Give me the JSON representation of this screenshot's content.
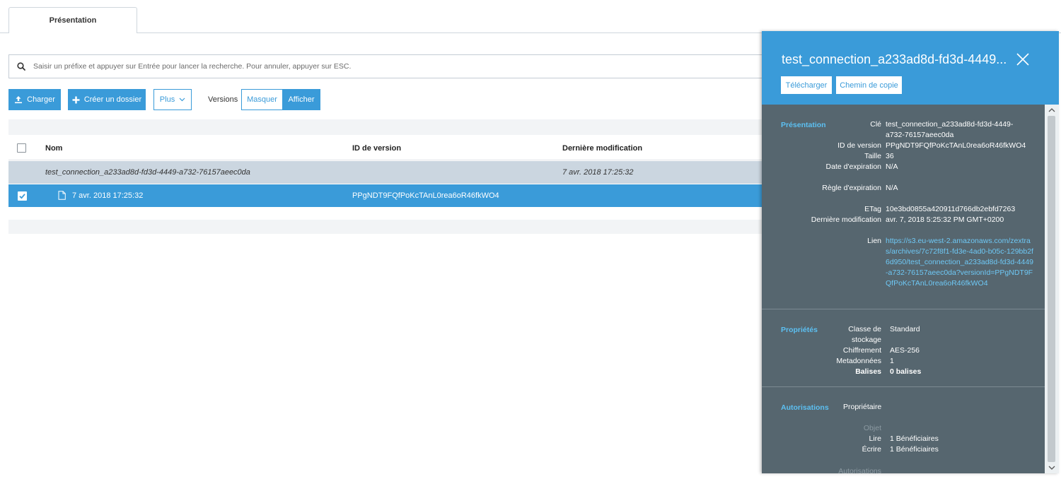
{
  "tabs": [
    {
      "label": "Présentation",
      "active": true
    }
  ],
  "search": {
    "placeholder": "Saisir un préfixe et appuyer sur Entrée pour lancer la recherche. Pour annuler, appuyer sur ESC."
  },
  "toolbar": {
    "upload_label": "Charger",
    "create_folder_label": "Créer un dossier",
    "more_label": "Plus",
    "versions_label": "Versions",
    "hide_label": "Masquer",
    "show_label": "Afficher"
  },
  "table": {
    "columns": {
      "name": "Nom",
      "version_id": "ID de version",
      "last_modified": "Dernière modification"
    },
    "rows": [
      {
        "name": "test_connection_a233ad8d-fd3d-4449-a732-76157aeec0da",
        "version_id": "",
        "last_modified": "7 avr. 2018 17:25:32",
        "selected": false
      },
      {
        "name": "7 avr. 2018 17:25:32",
        "version_id": "PPgNDT9FQfPoKcTAnL0rea6oR46fkWO4",
        "last_modified": "",
        "selected": true
      }
    ]
  },
  "panel": {
    "title": "test_connection_a233ad8d-fd3d-4449...",
    "download_label": "Télécharger",
    "copy_path_label": "Chemin de copie",
    "overview": {
      "section": "Présentation",
      "key_label": "Clé",
      "key_value": "test_connection_a233ad8d-fd3d-4449-a732-76157aeec0da",
      "version_label": "ID de version",
      "version_value": "PPgNDT9FQfPoKcTAnL0rea6oR46fkWO4",
      "size_label": "Taille",
      "size_value": "36",
      "expiration_label": "Date d'expiration",
      "expiration_value": "N/A",
      "rule_label": "Règle d'expiration",
      "rule_value": "N/A",
      "etag_label": "ETag",
      "etag_value": "10e3bd0855a420911d766db2ebfd7263",
      "modified_label": "Dernière modification",
      "modified_value": "avr. 7, 2018 5:25:32 PM GMT+0200",
      "link_label": "Lien",
      "link_value": "https://s3.eu-west-2.amazonaws.com/zextras/archives/7c72f8f1-fd3e-4ad0-b05c-129bb2f6d950/test_connection_a233ad8d-fd3d-4449-a732-76157aeec0da?versionId=PPgNDT9FQfPoKcTAnL0rea6oR46fkWO4"
    },
    "properties": {
      "section": "Propriétés",
      "storage_label": "Classe de stockage",
      "storage_value": "Standard",
      "encryption_label": "Chiffrement",
      "encryption_value": "AES-256",
      "metadata_label": "Metadonnées",
      "metadata_value": "1",
      "tags_label": "Balises",
      "tags_value": "0 balises"
    },
    "permissions": {
      "section": "Autorisations",
      "owner_label": "Propriétaire",
      "object_label": "Objet",
      "read_label": "Lire",
      "read_value": "1 Bénéficiaires",
      "write_label": "Écrire",
      "write_value": "1 Bénéficiaires",
      "permissions_label": "Autorisations"
    }
  },
  "colors": {
    "accent": "#3a9bd9",
    "panel_bg": "#56666f",
    "section_label": "#5cc0f2",
    "group_row": "#cbd6e0"
  }
}
